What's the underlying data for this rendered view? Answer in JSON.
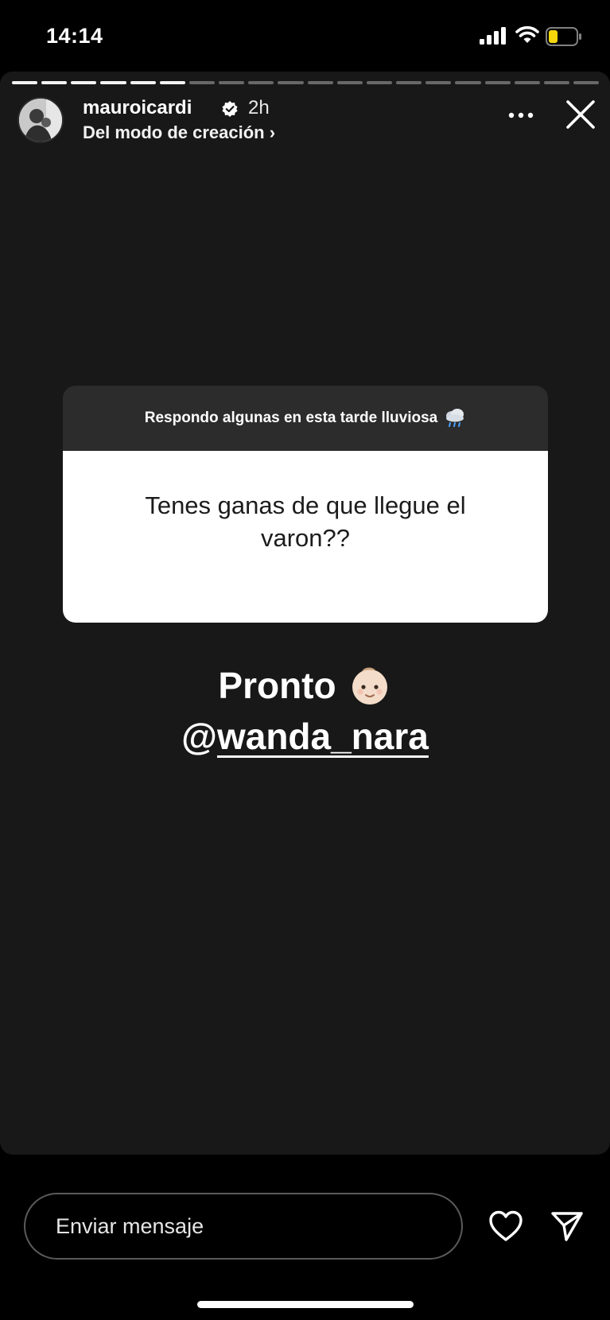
{
  "status_bar": {
    "time": "14:14",
    "battery_color": "#f5d60a"
  },
  "story": {
    "progress": {
      "segments": 20,
      "completed": 6
    },
    "header": {
      "username": "mauroicardi",
      "time_ago": "2h",
      "subtitle": "Del modo de creación ›",
      "avatar_icon": "profile-photo"
    },
    "sticker": {
      "header": "Respondo algunas en esta tarde lluviosa",
      "header_icon": "rain-cloud-icon",
      "question": "Tenes ganas de que llegue el varon??"
    },
    "reply": {
      "text": "Pronto",
      "emoji_icon": "baby-face-icon",
      "mention_at": "@",
      "mention_name": "wanda_nara"
    }
  },
  "bottom_bar": {
    "message_placeholder": "Enviar mensaje",
    "like_icon": "heart-icon",
    "send_icon": "paper-plane-icon"
  }
}
